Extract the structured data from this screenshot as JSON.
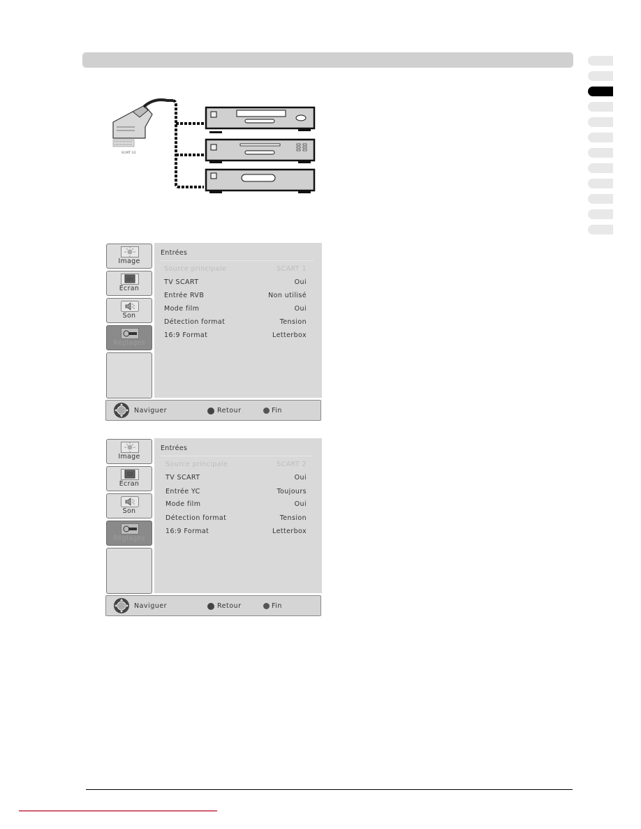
{
  "page": {
    "header_bar": "",
    "side_tabs": {
      "count": 12,
      "active_index": 2,
      "active_color": "#000000",
      "inactive_color": "#e8e8e8"
    }
  },
  "diagram": {
    "connector_label": "SCART 1/2",
    "devices": [
      "dvd-player",
      "cd-player",
      "vcr"
    ]
  },
  "osd_screens": [
    {
      "sidebar": [
        {
          "label": "Image",
          "icon": "image-sun-icon",
          "active": false
        },
        {
          "label": "Ecran",
          "icon": "screen-tv-icon",
          "active": false
        },
        {
          "label": "Son",
          "icon": "speaker-icon",
          "active": false
        },
        {
          "label": "Réglages",
          "icon": "settings-tools-icon",
          "active": true
        }
      ],
      "title": "Entrées",
      "rows": [
        {
          "label": "Source principale",
          "value": "SCART 1",
          "disabled": true
        },
        {
          "label": "TV SCART",
          "value": "Oui",
          "disabled": false
        },
        {
          "label": "Entrée RVB",
          "value": "Non utilisé",
          "disabled": false
        },
        {
          "label": "Mode film",
          "value": "Oui",
          "disabled": false
        },
        {
          "label": "Détection format",
          "value": "Tension",
          "disabled": false
        },
        {
          "label": "16:9 Format",
          "value": "Letterbox",
          "disabled": false
        }
      ],
      "footer": {
        "navigate": "Naviguer",
        "back": "Retour",
        "exit": "Fin"
      }
    },
    {
      "sidebar": [
        {
          "label": "Image",
          "icon": "image-sun-icon",
          "active": false
        },
        {
          "label": "Ecran",
          "icon": "screen-tv-icon",
          "active": false
        },
        {
          "label": "Son",
          "icon": "speaker-icon",
          "active": false
        },
        {
          "label": "Réglages",
          "icon": "settings-tools-icon",
          "active": true
        }
      ],
      "title": "Entrées",
      "rows": [
        {
          "label": "Source principale",
          "value": "SCART 2",
          "disabled": true
        },
        {
          "label": "TV SCART",
          "value": "Oui",
          "disabled": false
        },
        {
          "label": "Entrée YC",
          "value": "Toujours",
          "disabled": false
        },
        {
          "label": "Mode film",
          "value": "Oui",
          "disabled": false
        },
        {
          "label": "Détection format",
          "value": "Tension",
          "disabled": false
        },
        {
          "label": "16:9 Format",
          "value": "Letterbox",
          "disabled": false
        }
      ],
      "footer": {
        "navigate": "Naviguer",
        "back": "Retour",
        "exit": "Fin"
      }
    }
  ]
}
